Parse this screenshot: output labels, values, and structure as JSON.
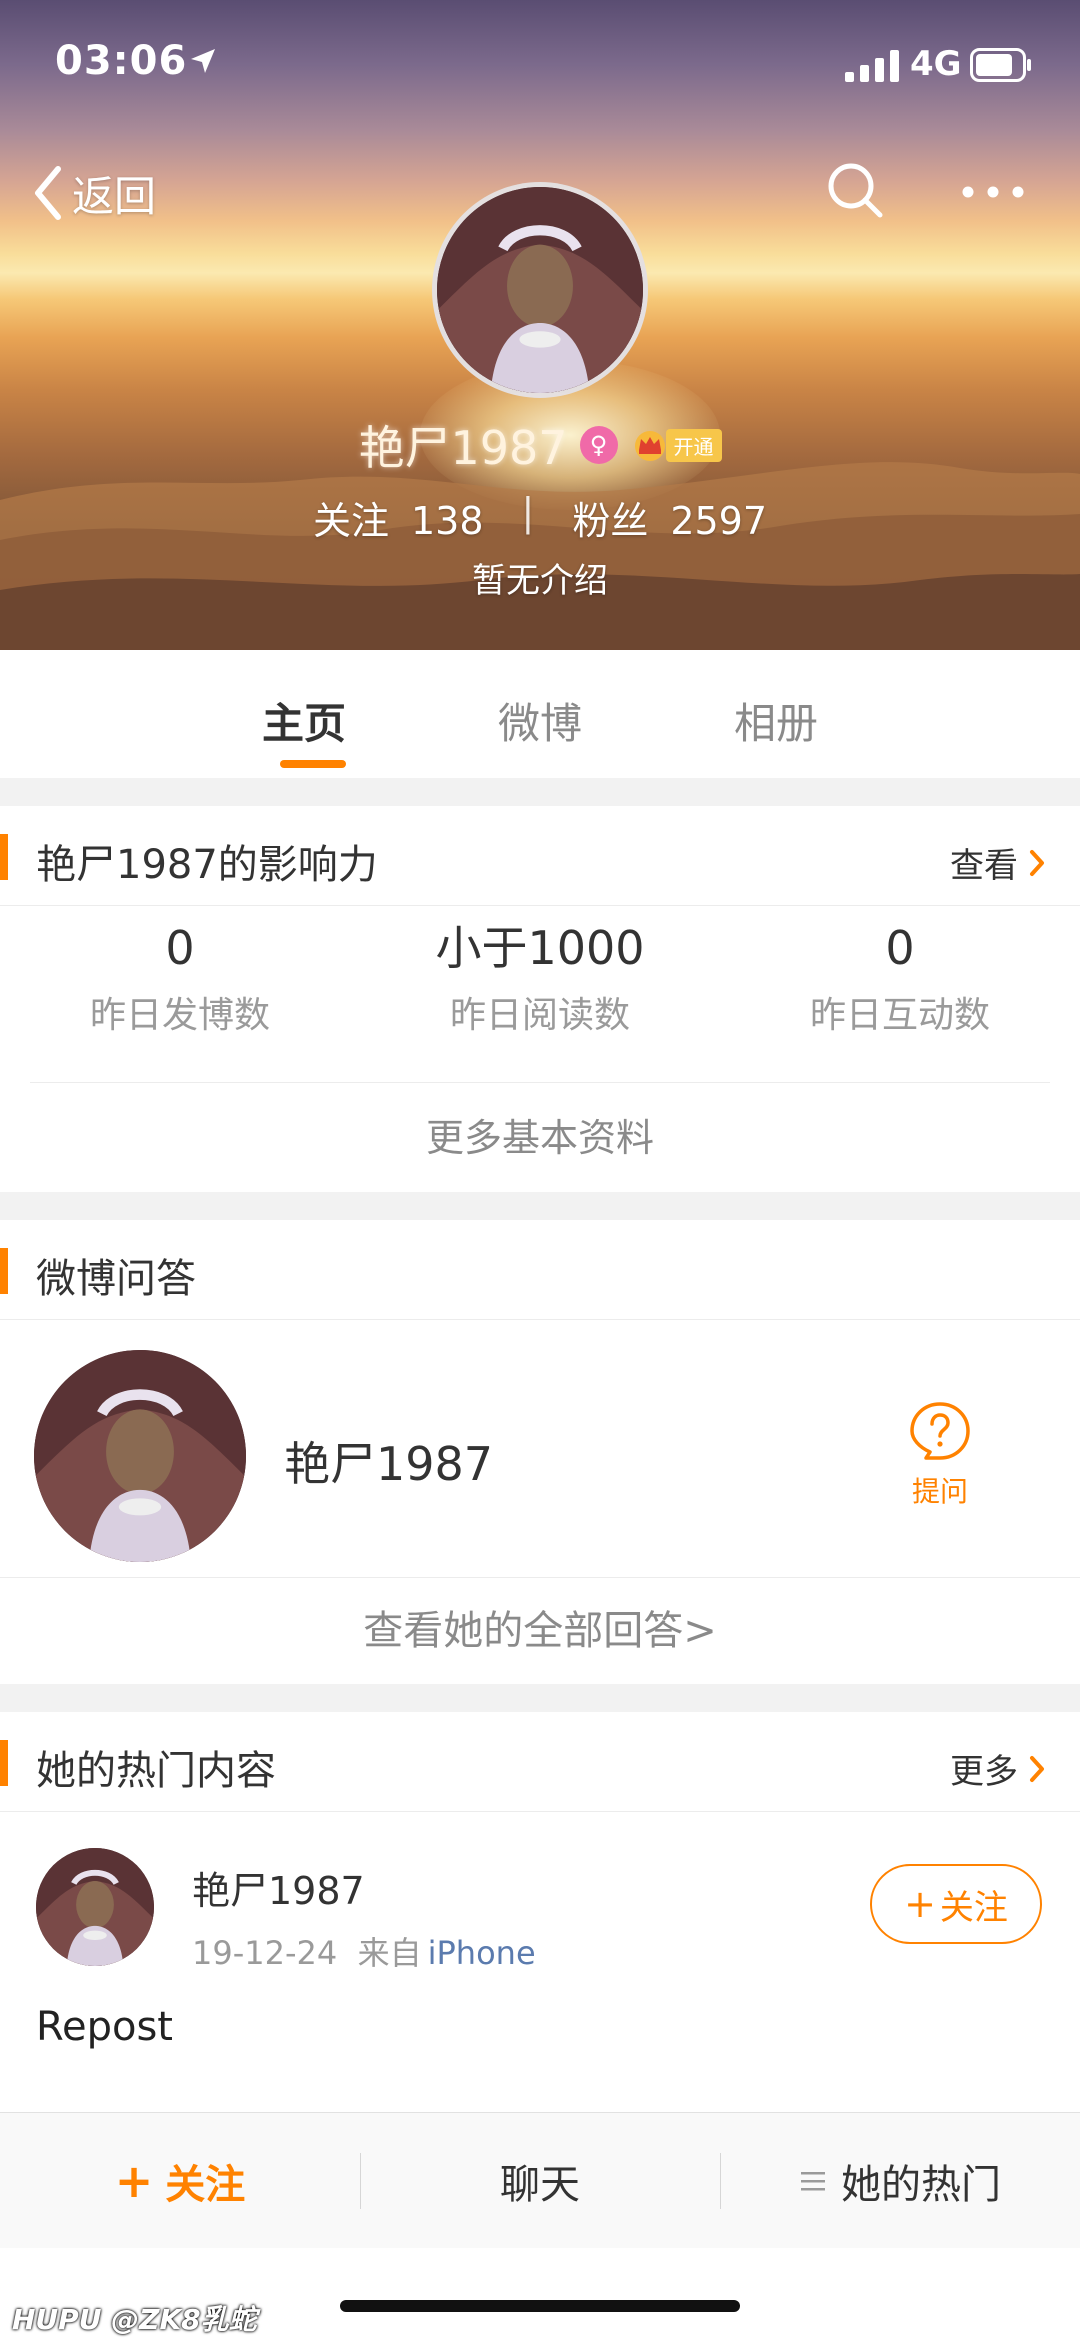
{
  "status_bar": {
    "time": "03:06",
    "network": "4G"
  },
  "nav": {
    "back_label": "返回"
  },
  "profile": {
    "name": "艳尸1987",
    "vip_open": "开通",
    "follow_label": "关注",
    "follow_count": "138",
    "divider": "|",
    "fans_label": "粉丝",
    "fans_count": "2597",
    "intro": "暂无介绍"
  },
  "tabs": [
    {
      "label": "主页",
      "active": true
    },
    {
      "label": "微博",
      "active": false
    },
    {
      "label": "相册",
      "active": false
    }
  ],
  "influence": {
    "title": "艳尸1987的影响力",
    "more_label": "查看",
    "stats": [
      {
        "value": "0",
        "label": "昨日发博数"
      },
      {
        "value": "小于1000",
        "label": "昨日阅读数"
      },
      {
        "value": "0",
        "label": "昨日互动数"
      }
    ],
    "more_info": "更多基本资料"
  },
  "qa": {
    "title": "微博问答",
    "name": "艳尸1987",
    "ask_label": "提问",
    "all_answers": "查看她的全部回答>"
  },
  "hot": {
    "title": "她的热门内容",
    "more_label": "更多",
    "post": {
      "author": "艳尸1987",
      "date": "19-12-24",
      "from_label": "来自",
      "source": "iPhone",
      "follow_label": "关注",
      "text": "Repost"
    }
  },
  "bottom_bar": {
    "follow": "关注",
    "chat": "聊天",
    "hot": "她的热门"
  },
  "watermark": "HUPU @ZK8乳蛇",
  "colors": {
    "accent": "#ff8200",
    "link": "#5b7bae",
    "gender_badge": "#f06aa8"
  }
}
